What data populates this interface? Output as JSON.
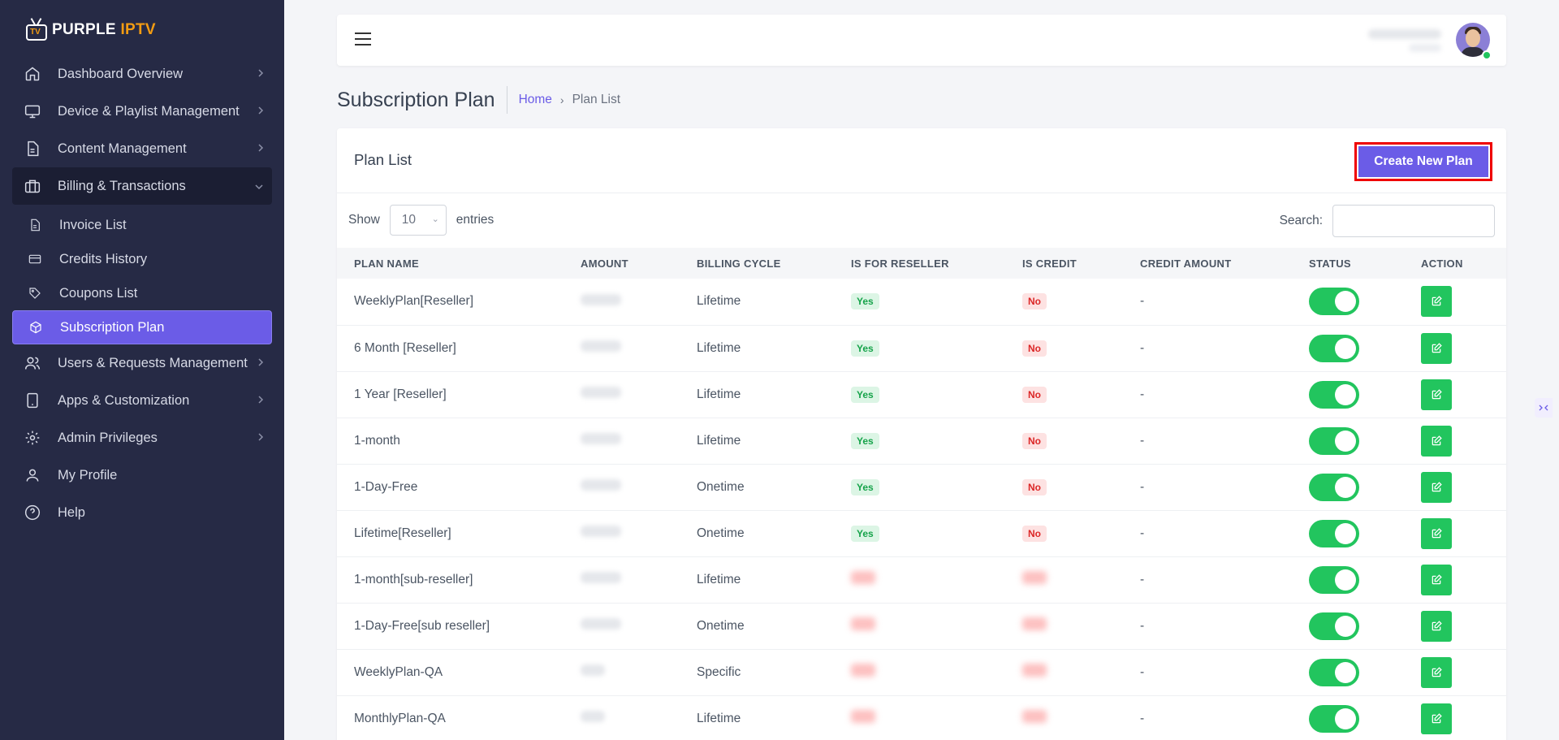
{
  "brand": {
    "part1": "PURPLE",
    "part2": "IPTV",
    "tv_label": "TV"
  },
  "sidebar": {
    "items": [
      {
        "label": "Dashboard Overview",
        "icon": "home-icon"
      },
      {
        "label": "Device & Playlist Management",
        "icon": "monitor-icon"
      },
      {
        "label": "Content Management",
        "icon": "document-icon"
      },
      {
        "label": "Billing & Transactions",
        "icon": "briefcase-icon"
      },
      {
        "label": "Users & Requests Management",
        "icon": "users-icon"
      },
      {
        "label": "Apps & Customization",
        "icon": "tablet-icon"
      },
      {
        "label": "Admin Privileges",
        "icon": "gear-icon"
      },
      {
        "label": "My Profile",
        "icon": "user-icon"
      },
      {
        "label": "Help",
        "icon": "help-icon"
      }
    ],
    "billing_sub": [
      {
        "label": "Invoice List",
        "icon": "invoice-icon"
      },
      {
        "label": "Credits History",
        "icon": "card-icon"
      },
      {
        "label": "Coupons List",
        "icon": "tag-icon"
      },
      {
        "label": "Subscription Plan",
        "icon": "cube-icon"
      }
    ]
  },
  "header": {
    "page_title": "Subscription Plan",
    "breadcrumb_home": "Home",
    "breadcrumb_sep": "›",
    "breadcrumb_current": "Plan List"
  },
  "card": {
    "title": "Plan List",
    "create_button": "Create New Plan",
    "show_label": "Show",
    "entries_value": "10",
    "entries_label": "entries",
    "search_label": "Search:"
  },
  "table": {
    "columns": [
      "PLAN NAME",
      "AMOUNT",
      "BILLING CYCLE",
      "IS FOR RESELLER",
      "IS CREDIT",
      "CREDIT AMOUNT",
      "STATUS",
      "ACTION"
    ],
    "rows": [
      {
        "name": "WeeklyPlan[Reseller]",
        "cycle": "Lifetime",
        "reseller": "Yes",
        "credit": "No",
        "credit_amount": "-"
      },
      {
        "name": "6 Month [Reseller]",
        "cycle": "Lifetime",
        "reseller": "Yes",
        "credit": "No",
        "credit_amount": "-"
      },
      {
        "name": "1 Year [Reseller]",
        "cycle": "Lifetime",
        "reseller": "Yes",
        "credit": "No",
        "credit_amount": "-"
      },
      {
        "name": "1-month",
        "cycle": "Lifetime",
        "reseller": "Yes",
        "credit": "No",
        "credit_amount": "-"
      },
      {
        "name": "1-Day-Free",
        "cycle": "Onetime",
        "reseller": "Yes",
        "credit": "No",
        "credit_amount": "-"
      },
      {
        "name": "Lifetime[Reseller]",
        "cycle": "Onetime",
        "reseller": "Yes",
        "credit": "No",
        "credit_amount": "-"
      },
      {
        "name": "1-month[sub-reseller]",
        "cycle": "Lifetime",
        "reseller": "",
        "credit": "",
        "credit_amount": "-"
      },
      {
        "name": "1-Day-Free[sub reseller]",
        "cycle": "Onetime",
        "reseller": "",
        "credit": "",
        "credit_amount": "-"
      },
      {
        "name": "WeeklyPlan-QA",
        "cycle": "Specific",
        "reseller": "",
        "credit": "",
        "credit_amount": "-"
      },
      {
        "name": "MonthlyPlan-QA",
        "cycle": "Lifetime",
        "reseller": "",
        "credit": "",
        "credit_amount": "-"
      }
    ]
  },
  "colors": {
    "sidebar_bg": "#262a45",
    "accent": "#6b5ce7",
    "success": "#22c55e",
    "highlight": "#ef0000"
  }
}
